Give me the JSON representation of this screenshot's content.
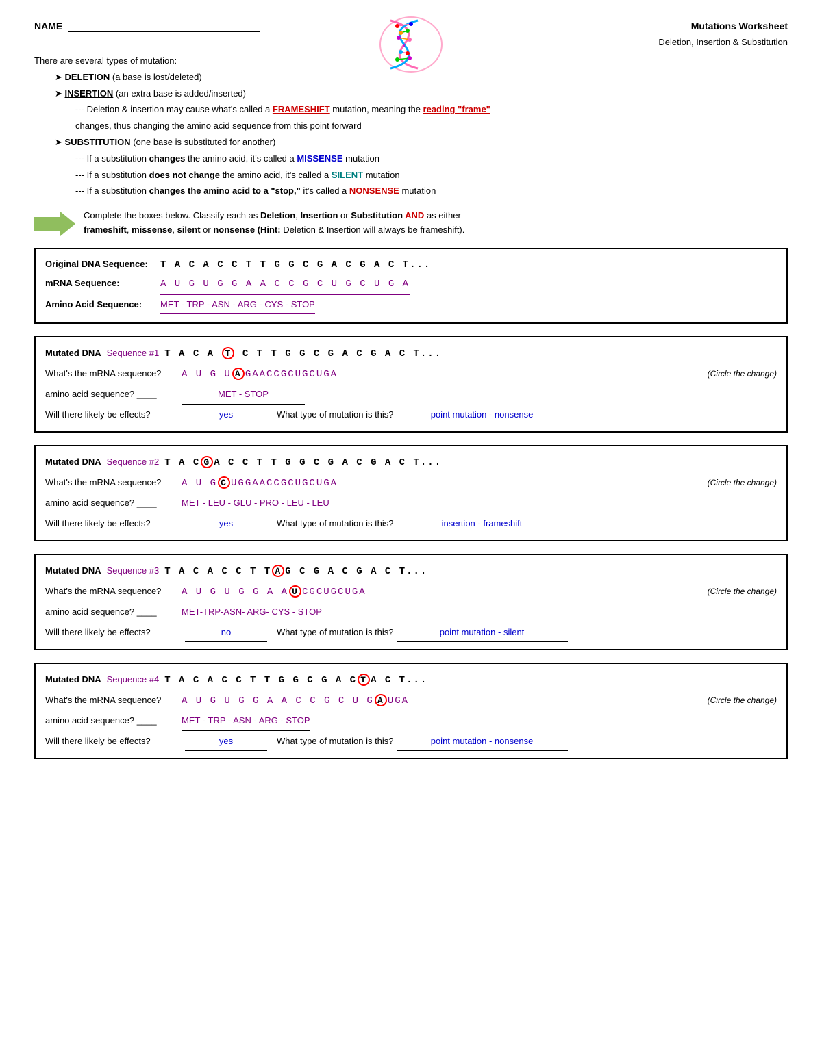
{
  "header": {
    "name_label": "NAME",
    "title": "Mutations Worksheet",
    "subtitle": "Deletion, Insertion & Substitution"
  },
  "intro": {
    "opening": "There are several types of mutation:",
    "deletion_label": "DELETION",
    "deletion_text": " (a base is lost/deleted)",
    "insertion_label": "INSERTION",
    "insertion_text": " (an extra base is added/inserted)",
    "frameshift_note1": "--- Deletion & insertion may cause what's called a ",
    "frameshift_word": "FRAMESHIFT",
    "frameshift_note2": " mutation, meaning the ",
    "reading_frame": "reading \"frame\"",
    "frameshift_note3": "changes, thus changing the amino acid sequence from this point forward",
    "substitution_label": "SUBSTITUTION",
    "substitution_text": " (one base is substituted for another)",
    "sub_note1": "--- If a substitution ",
    "sub_changes": "changes",
    "sub_note1b": " the amino acid, it's called a ",
    "missense": "MISSENSE",
    "sub_note1c": " mutation",
    "sub_note2": "--- If a substitution ",
    "sub_not_change": "does not change",
    "sub_note2b": " the amino acid, it's called a ",
    "silent": "SILENT",
    "sub_note2c": " mutation",
    "sub_note3": "--- If a substitution ",
    "sub_changes_stop": "changes the amino acid to a \"stop,\"",
    "sub_note3b": " it's called a ",
    "nonsense": "NONSENSE",
    "sub_note3c": " mutation"
  },
  "instruction": {
    "text1": "Complete the boxes below.  Classify each as ",
    "deletion": "Deletion",
    "comma1": ", ",
    "insertion": "Insertion",
    "or1": " or ",
    "substitution": "Substitution",
    "and": " AND",
    "text2": " as either",
    "frameshift": "frameshift",
    "comma2": ", ",
    "missense": "missense",
    "comma3": ", ",
    "silent": "silent",
    "or2": " or ",
    "nonsense": "nonsense",
    "hint": " (Hint:",
    "hint_text": " Deletion & Insertion will always be frameshift)."
  },
  "original": {
    "dna_label": "Original DNA Sequence:",
    "dna_seq": "T A C A C C T T G G C G A C G A C T",
    "dna_ellipsis": "...",
    "mrna_label": "mRNA Sequence:",
    "mrna_seq": "A U G U G G A A C C G C U G C U G A",
    "aa_label": "Amino Acid Sequence:",
    "aa_seq": "MET - TRP - ASN - ARG - CYS - STOP"
  },
  "mutation1": {
    "header": "Mutated DNA",
    "seq_label": "Sequence #1",
    "dna_before": "T A C A",
    "circled_letter": "T",
    "dna_after": "C T T G G C G A C G A C T",
    "dna_ellipsis": "...",
    "mrna_label": "What's the mRNA sequence?",
    "mrna_before": "A U G U",
    "mrna_circled": "A",
    "mrna_after": "GAACCGCUGCUGA",
    "circle_note": "(Circle the change)",
    "aa_label": "amino acid sequence?",
    "aa_answer": "MET - STOP",
    "effects_label": "Will there likely be effects?",
    "effects_answer": "yes",
    "type_label": "What type of mutation is this?",
    "type_answer": "point mutation - nonsense"
  },
  "mutation2": {
    "header": "Mutated DNA",
    "seq_label": "Sequence #2",
    "dna_before": "T A C",
    "circled_letter": "G",
    "dna_after": "A C C T T G G C G A C G A C T",
    "dna_ellipsis": "...",
    "mrna_label": "What's the mRNA sequence?",
    "mrna_before": "A U G",
    "mrna_circled": "C",
    "mrna_after": "UGGAACCGCUGCUGA",
    "circle_note": "(Circle the change)",
    "aa_label": "amino acid sequence?",
    "aa_answer": "MET - LEU - GLU - PRO - LEU - LEU",
    "effects_label": "Will there likely be effects?",
    "effects_answer": "yes",
    "type_label": "What type of mutation is this?",
    "type_answer": "insertion - frameshift"
  },
  "mutation3": {
    "header": "Mutated DNA",
    "seq_label": "Sequence #3",
    "dna_before": "T A C A C C T T",
    "circled_letter": "A",
    "dna_after": "G C G A C G A C T",
    "dna_ellipsis": "...",
    "mrna_label": "What's the mRNA sequence?",
    "mrna_before": "A U G U G G A A",
    "mrna_circled": "U",
    "mrna_after": "CGCUGCUGA",
    "circle_note": "(Circle the change)",
    "aa_label": "amino acid sequence?",
    "aa_answer": "MET-TRP-ASN- ARG- CYS - STOP",
    "effects_label": "Will there likely be effects?",
    "effects_answer": "no",
    "type_label": "What type of mutation is this?",
    "type_answer": "point mutation - silent"
  },
  "mutation4": {
    "header": "Mutated DNA",
    "seq_label": "Sequence #4",
    "dna_before": "T A C A C C T T G G C G A C",
    "circled_letter": "T",
    "dna_after": "A C T",
    "dna_ellipsis": "...",
    "mrna_label": "What's the mRNA sequence?",
    "mrna_before": "A U G U G G A A C C G C U G",
    "mrna_circled": "A",
    "mrna_after": "UGA",
    "circle_note": "(Circle the change)",
    "aa_label": "amino acid sequence?",
    "aa_answer": "MET - TRP - ASN - ARG - STOP",
    "effects_label": "Will there likely be effects?",
    "effects_answer": "yes",
    "type_label": "What type of mutation is this?",
    "type_answer": "point mutation - nonsense"
  }
}
